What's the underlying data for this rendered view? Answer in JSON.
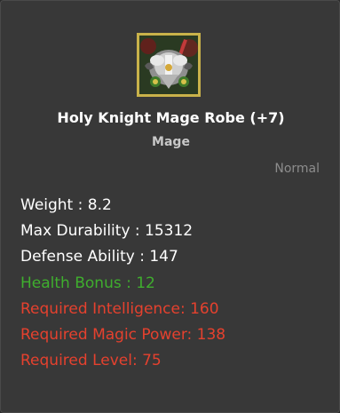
{
  "item": {
    "name": "Holy Knight Mage Robe (+7)",
    "class": "Mage",
    "rarity": "Normal",
    "icon": "armor-robe-icon"
  },
  "stats": {
    "weight": "Weight : 8.2",
    "max_durability": "Max Durability : 15312",
    "defense_ability": "Defense Ability : 147",
    "health_bonus": "Health Bonus : 12",
    "required_intelligence": "Required Intelligence: 160",
    "required_magic_power": "Required Magic Power: 138",
    "required_level": "Required Level: 75"
  },
  "colors": {
    "background": "#383838",
    "title": "#ffffff",
    "subtitle": "#c8c8c8",
    "rarity": "#8c8c8c",
    "stat": "#ffffff",
    "bonus": "#3fae2e",
    "requirement": "#e5412e",
    "icon_border": "#c9b24a"
  }
}
